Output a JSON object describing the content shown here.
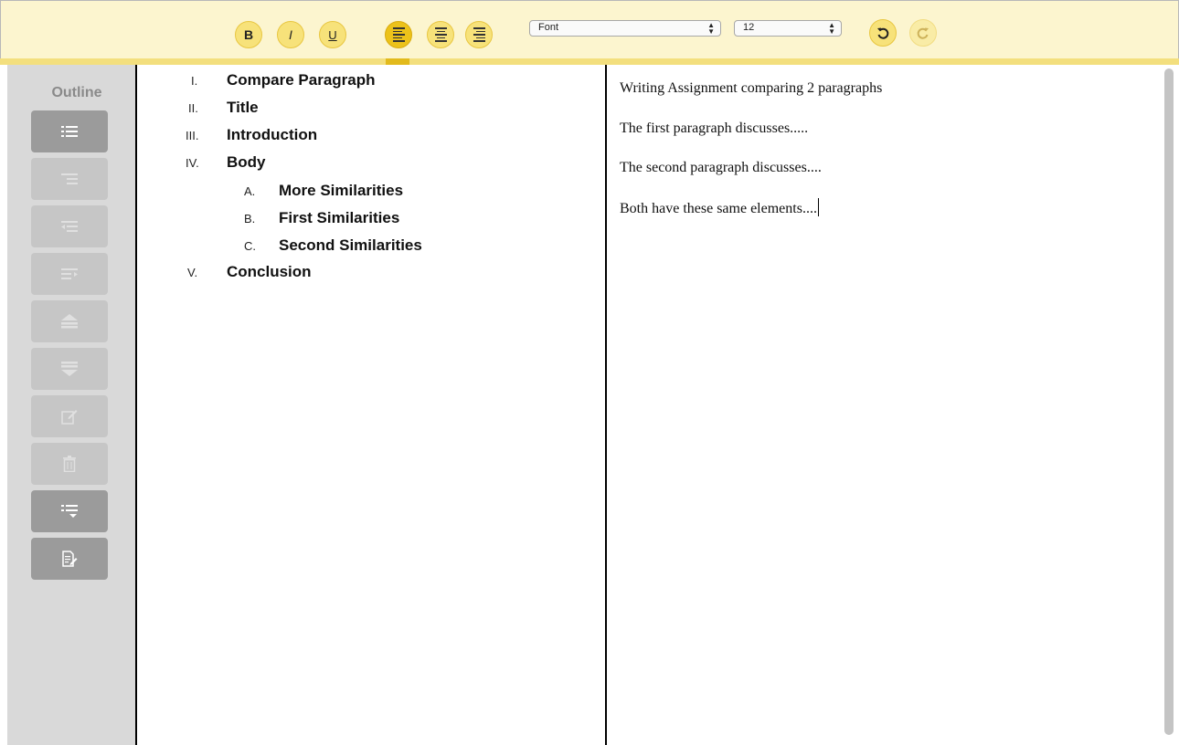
{
  "toolbar": {
    "bold_label": "B",
    "italic_label": "I",
    "underline_label": "U",
    "font_select": "Font",
    "size_select": "12",
    "active_align": "align-left",
    "accent": "#ecc21a"
  },
  "sidebar": {
    "title": "Outline"
  },
  "outline": {
    "items": [
      {
        "num": "I.",
        "text": "Compare Paragraph"
      },
      {
        "num": "II.",
        "text": "Title"
      },
      {
        "num": "III.",
        "text": "Introduction"
      },
      {
        "num": "IV.",
        "text": "Body"
      },
      {
        "num": "A.",
        "text": "More Similarities"
      },
      {
        "num": "B.",
        "text": "First Similarities"
      },
      {
        "num": "C.",
        "text": "Second Similarities"
      },
      {
        "num": "V.",
        "text": "Conclusion"
      }
    ]
  },
  "editor": {
    "paragraphs": [
      "Writing Assignment comparing 2 paragraphs",
      "The first paragraph discusses.....",
      "The second paragraph discusses....",
      "Both have these same elements...."
    ]
  }
}
